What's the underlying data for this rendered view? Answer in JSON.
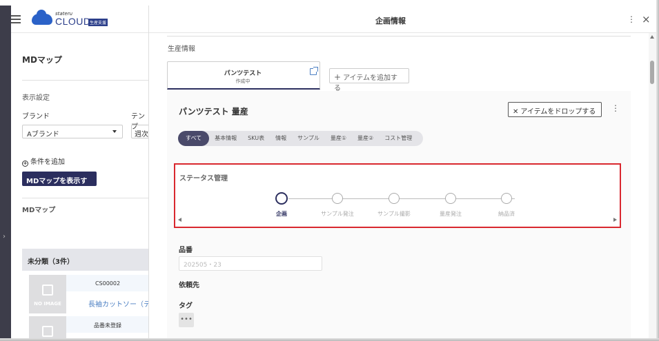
{
  "app": {
    "logo_small": "stateru",
    "logo_text": "CLOUD",
    "logo_badge": "生産支援"
  },
  "left": {
    "title": "MDマップ",
    "display_settings": "表示設定",
    "brand_label": "ブランド",
    "template_label": "テンプ",
    "brand_value": "Aブランド",
    "template_value": "週次",
    "add_condition": "条件を追加",
    "show_button": "MDマップを表示する",
    "md_map_sub": "MDマップ",
    "category_header": "未分類（3件）",
    "cards": [
      {
        "code": "CS00002",
        "name": "長袖カットソー（テ",
        "image": "NO IMAGE"
      },
      {
        "code": "品番未登録",
        "name": "",
        "image": ""
      }
    ]
  },
  "right": {
    "title": "企画情報",
    "section": "生産情報",
    "tab_title": "パンツテスト",
    "tab_sub": "作成中",
    "add_item": "アイテムを追加する",
    "item_title": "パンツテスト 量産",
    "drop_item": "アイテムをドロップする",
    "tabs": [
      "すべて",
      "基本情報",
      "SKU表",
      "情報",
      "サンプル",
      "量産①",
      "量産②",
      "コスト管理"
    ],
    "active_tab": "すべて",
    "status_title": "ステータス管理",
    "steps": [
      "企画",
      "サンプル発注",
      "サンプル撮影",
      "量産発注",
      "納品済"
    ],
    "active_step": "企画",
    "hinban_label": "品番",
    "hinban_value": "202505・23",
    "irai_label": "依頼先",
    "tag_label": "タグ",
    "tag_button": "•••"
  },
  "colors": {
    "accent": "#2b2e5e",
    "highlight": "#d9272e",
    "link": "#4a7ec2"
  }
}
